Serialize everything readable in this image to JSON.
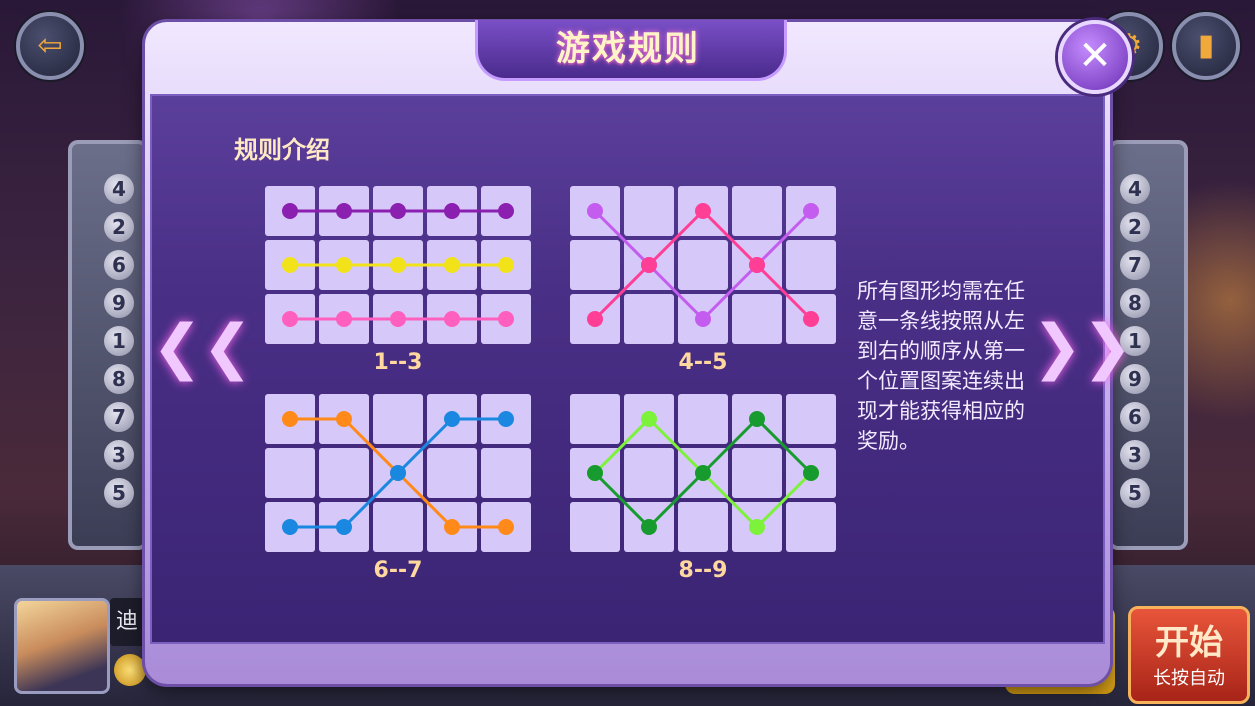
{
  "modal": {
    "title": "游戏规则",
    "section_title": "规则介绍",
    "description": "所有图形均需在任意一条线按照从左到右的顺序从第一个位置图案连续出现才能获得相应的奖励。",
    "close_label": "✕",
    "prev_label": "❮❮",
    "next_label": "❯❯"
  },
  "grids": [
    {
      "label": "1--3",
      "lines": [
        {
          "color": "#8a1fb0",
          "rows": [
            0,
            0,
            0,
            0,
            0
          ]
        },
        {
          "color": "#f2e21a",
          "rows": [
            1,
            1,
            1,
            1,
            1
          ]
        },
        {
          "color": "#ff5fbf",
          "rows": [
            2,
            2,
            2,
            2,
            2
          ]
        }
      ]
    },
    {
      "label": "4--5",
      "lines": [
        {
          "color": "#c45cf0",
          "rows": [
            0,
            1,
            2,
            1,
            0
          ]
        },
        {
          "color": "#ff3f96",
          "rows": [
            2,
            1,
            0,
            1,
            2
          ]
        }
      ]
    },
    {
      "label": "6--7",
      "lines": [
        {
          "color": "#ff8a1a",
          "rows": [
            0,
            0,
            1,
            2,
            2
          ]
        },
        {
          "color": "#1a88e0",
          "rows": [
            2,
            2,
            1,
            0,
            0
          ]
        }
      ]
    },
    {
      "label": "8--9",
      "lines": [
        {
          "color": "#7cf23a",
          "rows": [
            1,
            0,
            1,
            2,
            1
          ]
        },
        {
          "color": "#179a2e",
          "rows": [
            1,
            2,
            1,
            0,
            1
          ]
        }
      ]
    }
  ],
  "left_numbers": [
    "4",
    "2",
    "6",
    "9",
    "1",
    "8",
    "7",
    "3",
    "5"
  ],
  "right_numbers": [
    "4",
    "2",
    "7",
    "8",
    "1",
    "9",
    "6",
    "3",
    "5"
  ],
  "player": {
    "name": "迪"
  },
  "start_button": {
    "label": "开始",
    "sublabel": "长按自动"
  }
}
